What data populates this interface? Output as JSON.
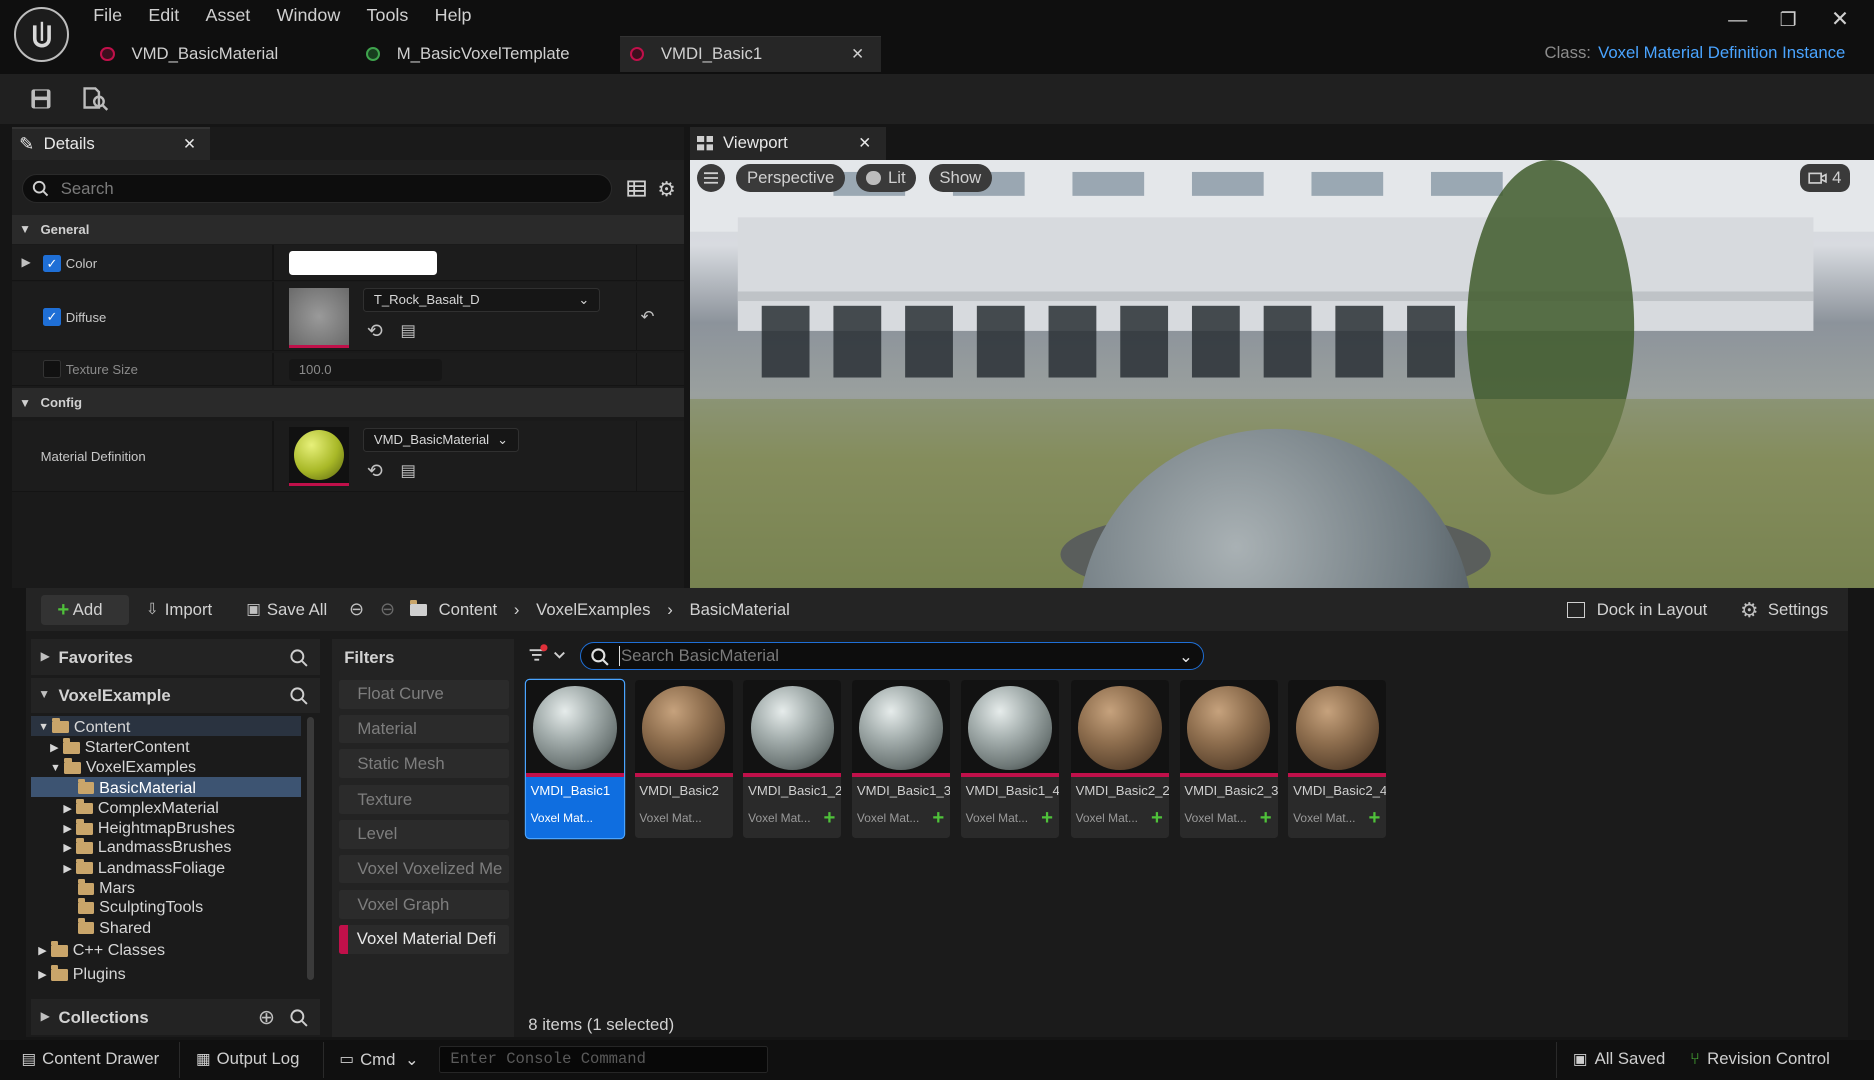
{
  "menu": [
    "File",
    "Edit",
    "Asset",
    "Window",
    "Tools",
    "Help"
  ],
  "tabs": [
    {
      "label": "VMD_BasicMaterial",
      "color": "#c0104a"
    },
    {
      "label": "M_BasicVoxelTemplate",
      "color": "#3fa34d"
    },
    {
      "label": "VMDI_Basic1",
      "color": "#c0104a",
      "active": true
    }
  ],
  "class_label": {
    "key": "Class:",
    "value": "Voxel Material Definition Instance"
  },
  "details": {
    "tab_label": "Details",
    "search_placeholder": "Search",
    "sections": {
      "general": "General",
      "config": "Config"
    },
    "props": {
      "color": {
        "label": "Color",
        "value_color": "#ffffff",
        "checked": true
      },
      "diffuse": {
        "label": "Diffuse",
        "asset": "T_Rock_Basalt_D",
        "checked": true
      },
      "texture_size": {
        "label": "Texture Size",
        "value": "100.0",
        "checked": false
      },
      "material_definition": {
        "label": "Material Definition",
        "asset": "VMD_BasicMaterial"
      }
    }
  },
  "viewport": {
    "tab_label": "Viewport",
    "perspective": "Perspective",
    "lit": "Lit",
    "show": "Show",
    "camera_speed": "4"
  },
  "content_browser": {
    "add": "Add",
    "import": "Import",
    "save_all": "Save All",
    "breadcrumb": [
      "Content",
      "VoxelExamples",
      "BasicMaterial"
    ],
    "dock_in_layout": "Dock in Layout",
    "settings": "Settings",
    "favorites": "Favorites",
    "project": "VoxelExample",
    "filters_title": "Filters",
    "search_placeholder": "Search BasicMaterial",
    "collections": "Collections",
    "item_count": "8 items (1 selected)",
    "tree": [
      {
        "label": "Content"
      },
      {
        "label": "StarterContent"
      },
      {
        "label": "VoxelExamples"
      },
      {
        "label": "BasicMaterial",
        "selected": true
      },
      {
        "label": "ComplexMaterial"
      },
      {
        "label": "HeightmapBrushes"
      },
      {
        "label": "LandmassBrushes"
      },
      {
        "label": "LandmassFoliage"
      },
      {
        "label": "Mars"
      },
      {
        "label": "SculptingTools"
      },
      {
        "label": "Shared"
      },
      {
        "label": "C++ Classes"
      },
      {
        "label": "Plugins"
      }
    ],
    "filters": [
      "Float Curve",
      "Material",
      "Static Mesh",
      "Texture",
      "Level",
      "Voxel Voxelized Me",
      "Voxel Graph",
      "Voxel Material Defi"
    ],
    "assets": [
      {
        "name": "VMDI_Basic1",
        "type": "Voxel Mat...",
        "material": "rock",
        "selected": true
      },
      {
        "name": "VMDI_Basic2",
        "type": "Voxel Mat...",
        "material": "wood"
      },
      {
        "name": "VMDI_Basic1_2",
        "type": "Voxel Mat...",
        "material": "rock"
      },
      {
        "name": "VMDI_Basic1_3",
        "type": "Voxel Mat...",
        "material": "rock"
      },
      {
        "name": "VMDI_Basic1_4",
        "type": "Voxel Mat...",
        "material": "rock"
      },
      {
        "name": "VMDI_Basic2_2",
        "type": "Voxel Mat...",
        "material": "wood"
      },
      {
        "name": "VMDI_Basic2_3",
        "type": "Voxel Mat...",
        "material": "wood"
      },
      {
        "name": "VMDI_Basic2_4",
        "type": "Voxel Mat...",
        "material": "wood"
      }
    ]
  },
  "status": {
    "content_drawer": "Content Drawer",
    "output_log": "Output Log",
    "cmd": "Cmd",
    "console_placeholder": "Enter Console Command",
    "all_saved": "All Saved",
    "revision_control": "Revision Control"
  },
  "colors": {
    "accent": "#1f6fd6",
    "link": "#4aa4ff",
    "asset_bar": "#c0104a",
    "add_green": "#4fc13a"
  }
}
